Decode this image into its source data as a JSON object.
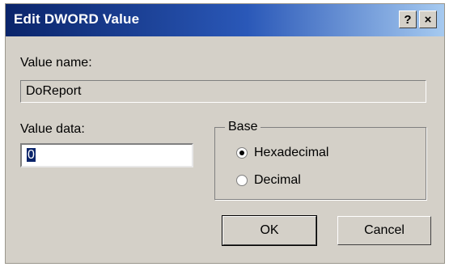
{
  "window": {
    "title": "Edit DWORD Value",
    "help_label": "?",
    "close_label": "×"
  },
  "value_name": {
    "label": "Value name:",
    "value": "DoReport"
  },
  "value_data": {
    "label": "Value data:",
    "value": "0"
  },
  "base": {
    "label": "Base",
    "options": [
      {
        "label": "Hexadecimal",
        "selected": true
      },
      {
        "label": "Decimal",
        "selected": false
      }
    ]
  },
  "buttons": {
    "ok": "OK",
    "cancel": "Cancel"
  }
}
